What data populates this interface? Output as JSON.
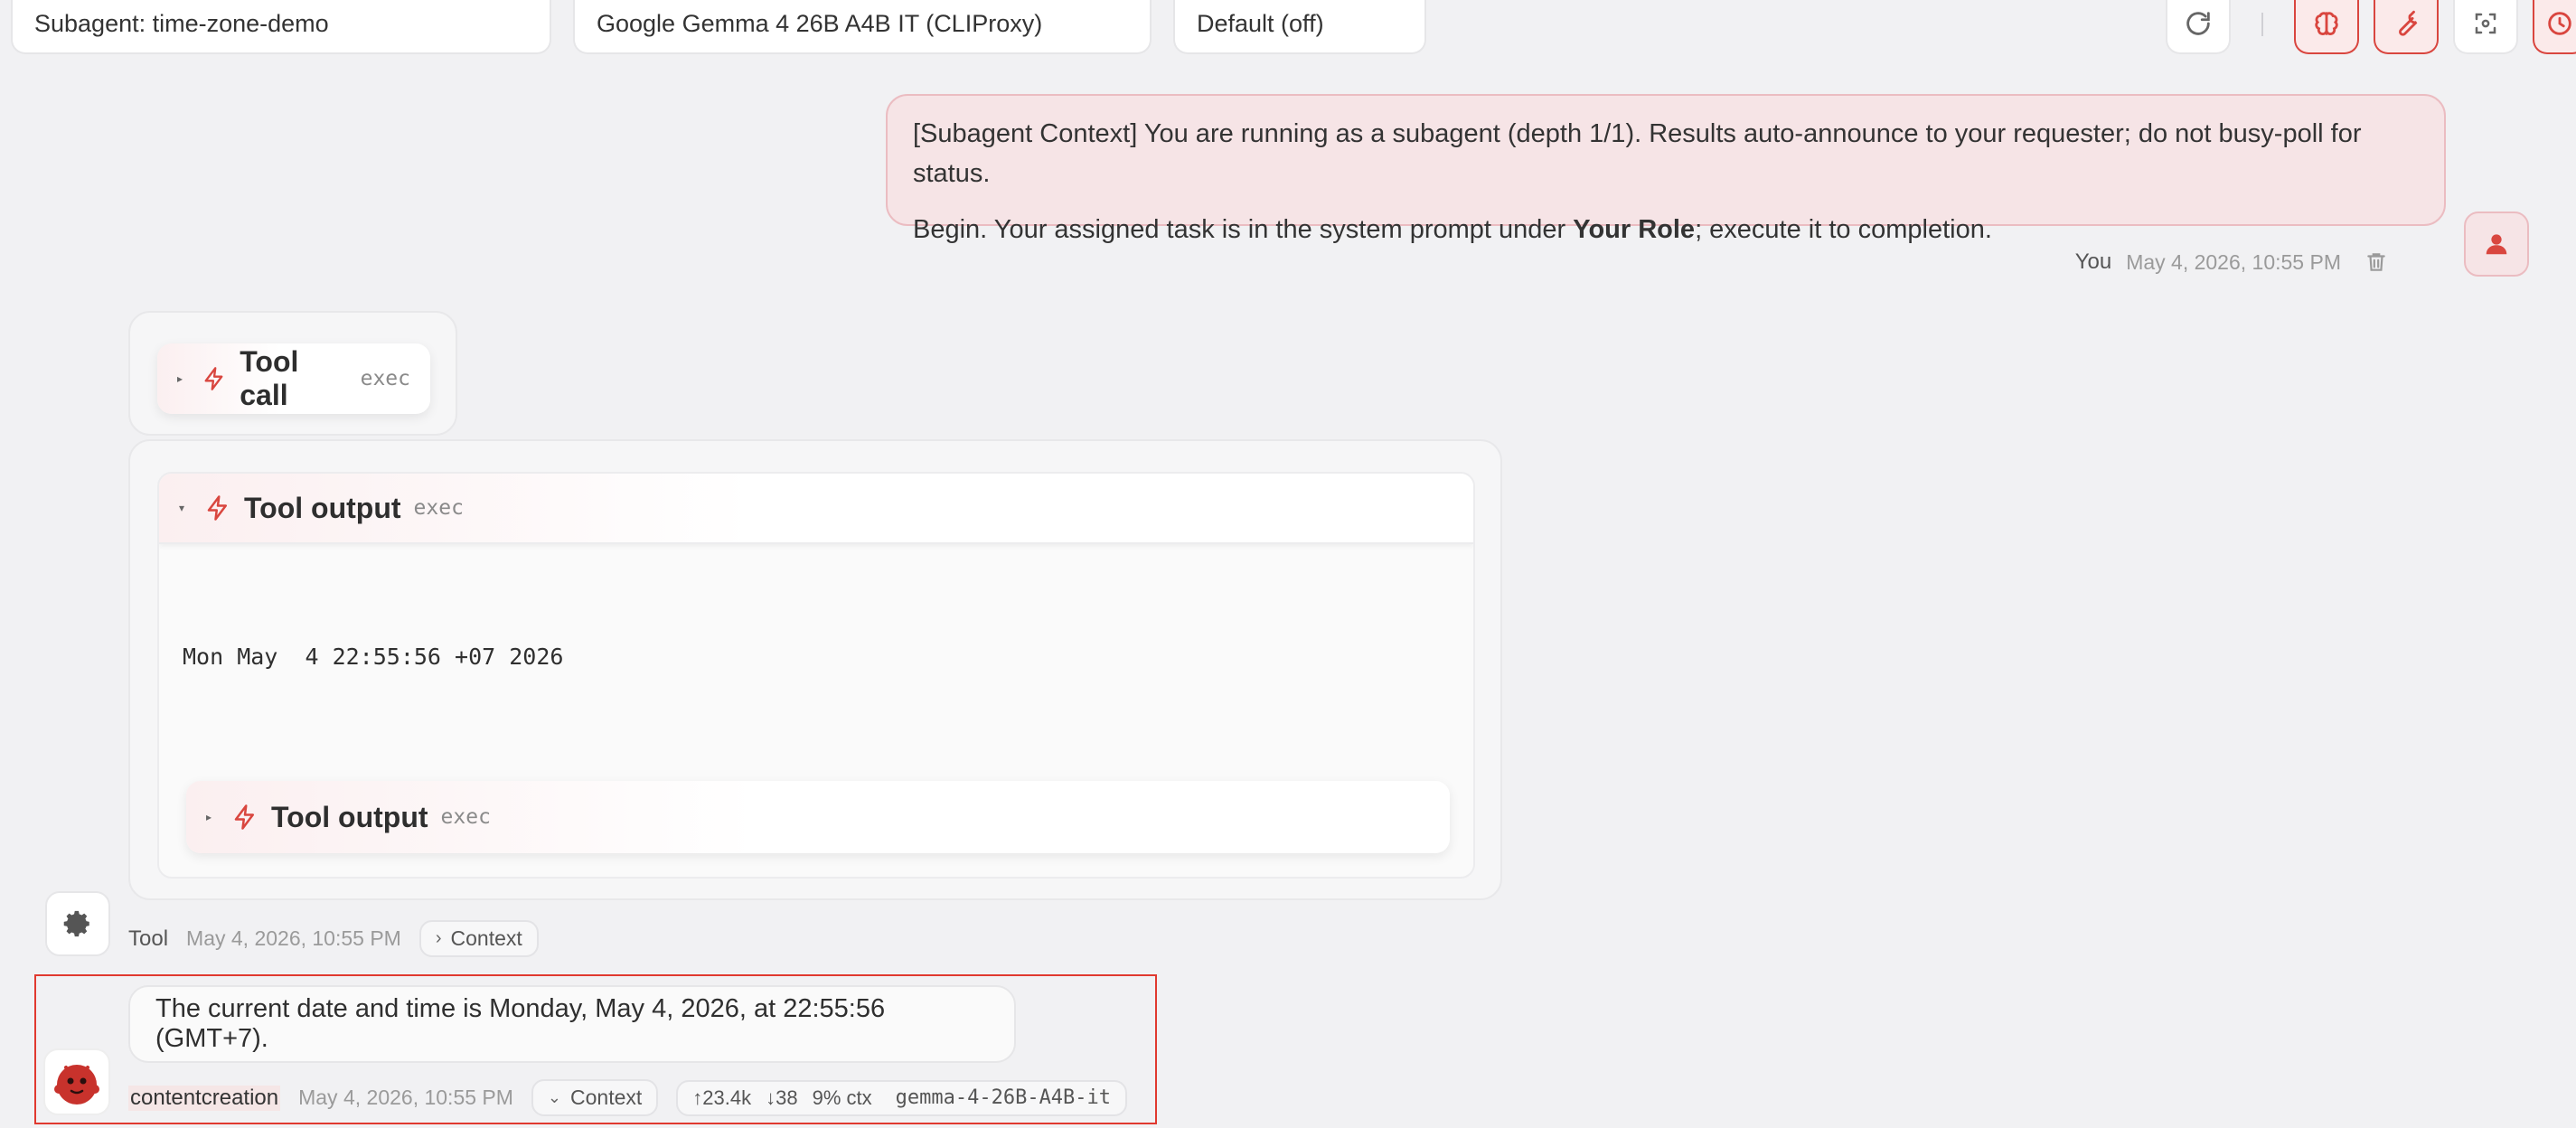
{
  "header": {
    "agent_select": "Subagent: time-zone-demo",
    "model_select": "Google Gemma 4 26B A4B IT (CLIProxy)",
    "thinking_select": "Default (off)",
    "icons": [
      "refresh-icon",
      "brain-icon",
      "wrench-icon",
      "screenshot-icon",
      "clock-icon"
    ]
  },
  "user_message": {
    "line1": "[Subagent Context] You are running as a subagent (depth 1/1). Results auto-announce to your requester; do not busy-poll for status.",
    "line2_before": "Begin. Your assigned task is in the system prompt under ",
    "line2_bold": "Your Role",
    "line2_after": "; execute it to completion.",
    "author": "You",
    "time": "May 4, 2026, 10:55 PM"
  },
  "tool_call": {
    "title": "Tool call",
    "sub": "exec"
  },
  "tool_output": {
    "title": "Tool output",
    "sub": "exec",
    "content": "Mon May  4 22:55:56 +07 2026",
    "nested_title": "Tool output",
    "nested_sub": "exec"
  },
  "tool_meta": {
    "author": "Tool",
    "time": "May 4, 2026, 10:55 PM",
    "context_label": "Context"
  },
  "assistant_message": {
    "text": "The current date and time is Monday, May 4, 2026, at 22:55:56 (GMT+7).",
    "author": "contentcreation",
    "time": "May 4, 2026, 10:55 PM",
    "context_label": "Context",
    "tokens_in": "↑23.4k",
    "tokens_out": "↓38",
    "ctx": "9% ctx",
    "model": "gemma-4-26B-A4B-it"
  },
  "colors": {
    "accent": "#d9463f",
    "user_bubble": "#f6e4e6",
    "background": "#f1f1f3"
  }
}
